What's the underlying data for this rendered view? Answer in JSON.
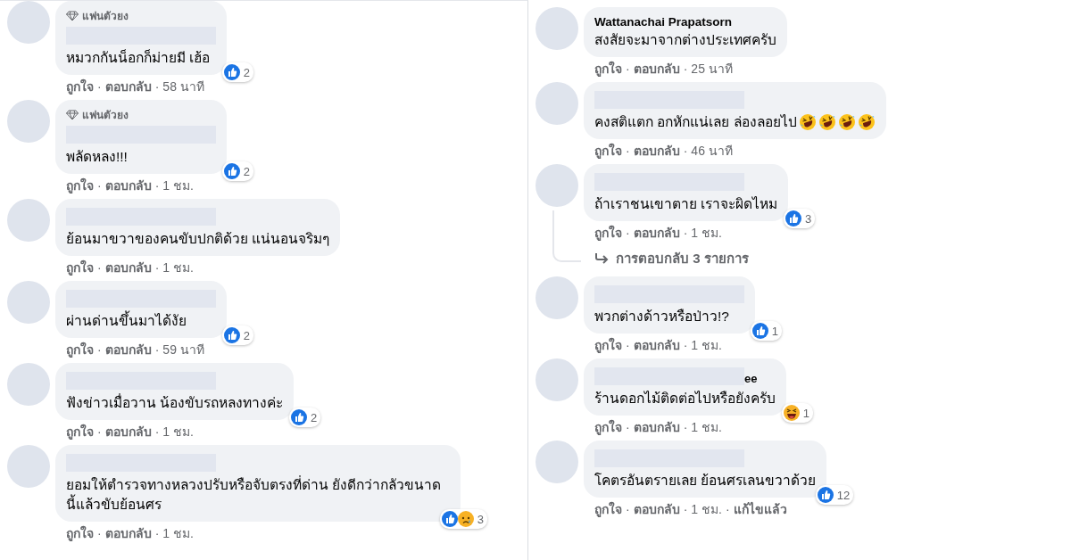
{
  "columns": [
    {
      "comments": [
        {
          "badge": "แฟนตัวยง",
          "name": {
            "kind": "redacted"
          },
          "text": "หมวกกันน็อกก็ม่ายมี เฮ้อ",
          "reactions": [
            {
              "kind": "like"
            }
          ],
          "reaction_count": "2",
          "meta": [
            "ถูกใจ",
            "·",
            "ตอบกลับ",
            "·",
            "58 นาที"
          ]
        },
        {
          "badge": "แฟนตัวยง",
          "name": {
            "kind": "redacted"
          },
          "text": "พลัดหลง!!!",
          "reactions": [
            {
              "kind": "like"
            }
          ],
          "reaction_count": "2",
          "meta": [
            "ถูกใจ",
            "·",
            "ตอบกลับ",
            "·",
            "1 ชม."
          ]
        },
        {
          "name": {
            "kind": "redacted"
          },
          "text": "ย้อนมาขวาของคนขับปกติด้วย แน่นอนจริมๆ",
          "meta": [
            "ถูกใจ",
            "·",
            "ตอบกลับ",
            "·",
            "1 ชม."
          ]
        },
        {
          "name": {
            "kind": "redacted"
          },
          "text": "ผ่านด่านขึ้นมาได้งัย",
          "reactions": [
            {
              "kind": "like"
            }
          ],
          "reaction_count": "2",
          "meta": [
            "ถูกใจ",
            "·",
            "ตอบกลับ",
            "·",
            "59 นาที"
          ]
        },
        {
          "name": {
            "kind": "redacted"
          },
          "text": "ฟังข่าวเมื่อวาน น้องขับรถหลงทางค่ะ",
          "reactions": [
            {
              "kind": "like"
            }
          ],
          "reaction_count": "2",
          "meta": [
            "ถูกใจ",
            "·",
            "ตอบกลับ",
            "·",
            "1 ชม."
          ]
        },
        {
          "name": {
            "kind": "redacted"
          },
          "text": "ยอมให้ตำรวจทางหลวงปรับหรือจับตรงที่ด่าน ยังดีกว่ากลัวขนาดนี้แล้วขับย้อนศร",
          "reactions": [
            {
              "kind": "like"
            },
            {
              "kind": "sad"
            }
          ],
          "reaction_count": "3",
          "meta": [
            "ถูกใจ",
            "·",
            "ตอบกลับ",
            "·",
            "1 ชม."
          ]
        }
      ]
    },
    {
      "comments": [
        {
          "name": {
            "kind": "text",
            "text": "Wattanachai Prapatsorn"
          },
          "text": "สงสัยจะมาจากต่างประเทศครับ",
          "meta": [
            "ถูกใจ",
            "·",
            "ตอบกลับ",
            "·",
            "25 นาที"
          ]
        },
        {
          "name": {
            "kind": "redacted"
          },
          "text": "คงสติแตก อกหักแน่เลย ล่องลอยไป",
          "emoji": [
            {
              "kind": "rofl"
            },
            {
              "kind": "rofl"
            },
            {
              "kind": "rofl"
            },
            {
              "kind": "rofl"
            }
          ],
          "meta": [
            "ถูกใจ",
            "·",
            "ตอบกลับ",
            "·",
            "46 นาที"
          ]
        },
        {
          "name": {
            "kind": "redacted"
          },
          "text": "ถ้าเราชนเขาตาย เราจะผิดไหม",
          "reactions": [
            {
              "kind": "like"
            }
          ],
          "reaction_count": "3",
          "meta": [
            "ถูกใจ",
            "·",
            "ตอบกลับ",
            "·",
            "1 ชม."
          ],
          "replies_link": "การตอบกลับ 3 รายการ"
        },
        {
          "name": {
            "kind": "redacted"
          },
          "text": "พวกต่างด้าวหรือป่าว!?",
          "reactions": [
            {
              "kind": "like"
            }
          ],
          "reaction_count": "1",
          "meta": [
            "ถูกใจ",
            "·",
            "ตอบกลับ",
            "·",
            "1 ชม."
          ]
        },
        {
          "name": {
            "kind": "redacted",
            "suffix": "ee"
          },
          "text": "ร้านดอกไม้ติดต่อไปหรือยังครับ",
          "reactions": [
            {
              "kind": "haha"
            }
          ],
          "reaction_count": "1",
          "meta": [
            "ถูกใจ",
            "·",
            "ตอบกลับ",
            "·",
            "1 ชม."
          ]
        },
        {
          "name": {
            "kind": "redacted"
          },
          "text": "โคตรอันตรายเลย ย้อนศรเลนขวาด้วย",
          "reactions": [
            {
              "kind": "like"
            }
          ],
          "reaction_count": "12",
          "meta": [
            "ถูกใจ",
            "·",
            "ตอบกลับ",
            "·",
            "1 ชม.",
            "·",
            "แก้ไขแล้ว"
          ]
        }
      ]
    }
  ]
}
